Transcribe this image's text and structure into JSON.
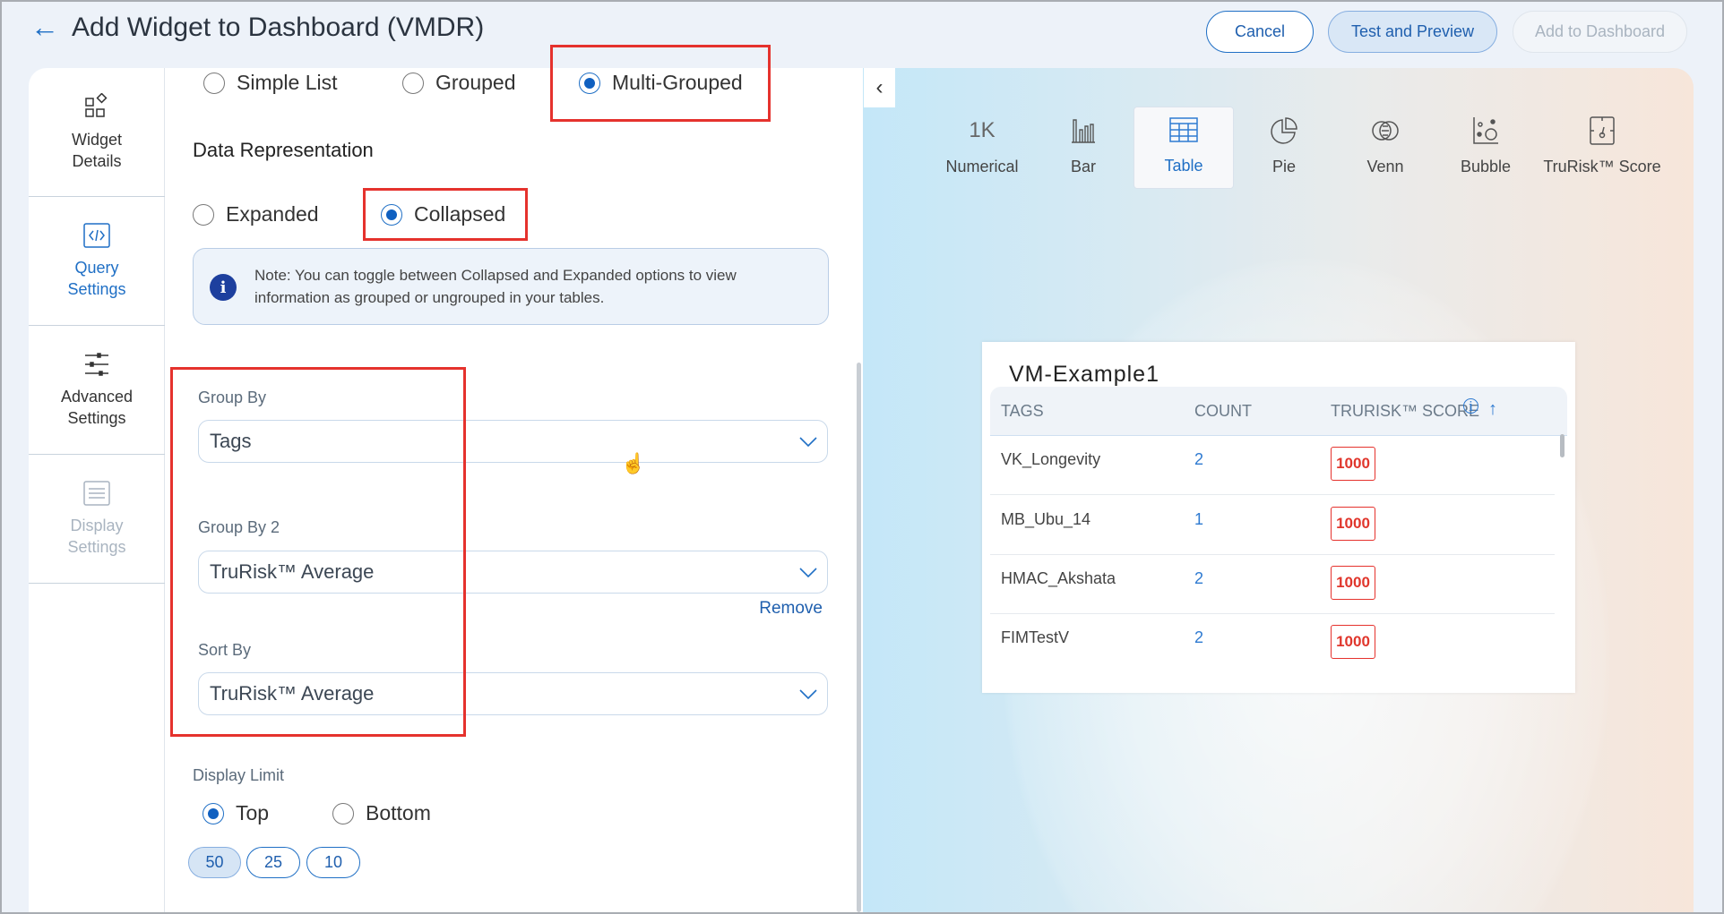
{
  "header": {
    "title": "Add Widget to Dashboard (VMDR)",
    "cancel": "Cancel",
    "test_preview": "Test and Preview",
    "add_to_dashboard": "Add to Dashboard"
  },
  "sidebar": {
    "items": [
      {
        "label1": "Widget",
        "label2": "Details",
        "icon": "widget-icon"
      },
      {
        "label1": "Query",
        "label2": "Settings",
        "icon": "code-icon",
        "active": true
      },
      {
        "label1": "Advanced",
        "label2": "Settings",
        "icon": "sliders-icon"
      },
      {
        "label1": "Display",
        "label2": "Settings",
        "icon": "display-settings-icon",
        "disabled": true
      }
    ]
  },
  "form": {
    "list_types": [
      {
        "label": "Simple List",
        "selected": false
      },
      {
        "label": "Grouped",
        "selected": false
      },
      {
        "label": "Multi-Grouped",
        "selected": true
      }
    ],
    "data_representation": {
      "title": "Data Representation",
      "options": [
        {
          "label": "Expanded",
          "selected": false
        },
        {
          "label": "Collapsed",
          "selected": true
        }
      ]
    },
    "note": "Note: You can toggle between Collapsed and Expanded options to view information as grouped or ungrouped in your tables.",
    "group_by": {
      "label": "Group By",
      "value": "Tags"
    },
    "group_by_2": {
      "label": "Group By 2",
      "value": "TruRisk™ Average",
      "remove": "Remove"
    },
    "sort_by": {
      "label": "Sort By",
      "value": "TruRisk™ Average"
    },
    "display_limit": {
      "label": "Display Limit",
      "options": [
        {
          "label": "Top",
          "selected": true
        },
        {
          "label": "Bottom",
          "selected": false
        }
      ],
      "counts": [
        {
          "label": "50",
          "selected": true
        },
        {
          "label": "25",
          "selected": false
        },
        {
          "label": "10",
          "selected": false
        }
      ]
    }
  },
  "chart_types": [
    {
      "label": "Numerical",
      "glyph": "1K"
    },
    {
      "label": "Bar"
    },
    {
      "label": "Table",
      "selected": true
    },
    {
      "label": "Pie"
    },
    {
      "label": "Venn"
    },
    {
      "label": "Bubble"
    },
    {
      "label": "TruRisk™ Score"
    }
  ],
  "preview": {
    "title": "VM-Example1",
    "columns": [
      "TAGS",
      "COUNT",
      "TRURISK™ SCORE"
    ],
    "rows": [
      {
        "tag": "VK_Longevity",
        "count": "2",
        "score": "1000"
      },
      {
        "tag": "MB_Ubu_14",
        "count": "1",
        "score": "1000"
      },
      {
        "tag": "HMAC_Akshata",
        "count": "2",
        "score": "1000"
      },
      {
        "tag": "FIMTestV",
        "count": "2",
        "score": "1000"
      }
    ]
  },
  "colors": {
    "accent": "#1f6fc5",
    "highlight_box": "#e5322d",
    "score_critical": "#e0362c"
  }
}
